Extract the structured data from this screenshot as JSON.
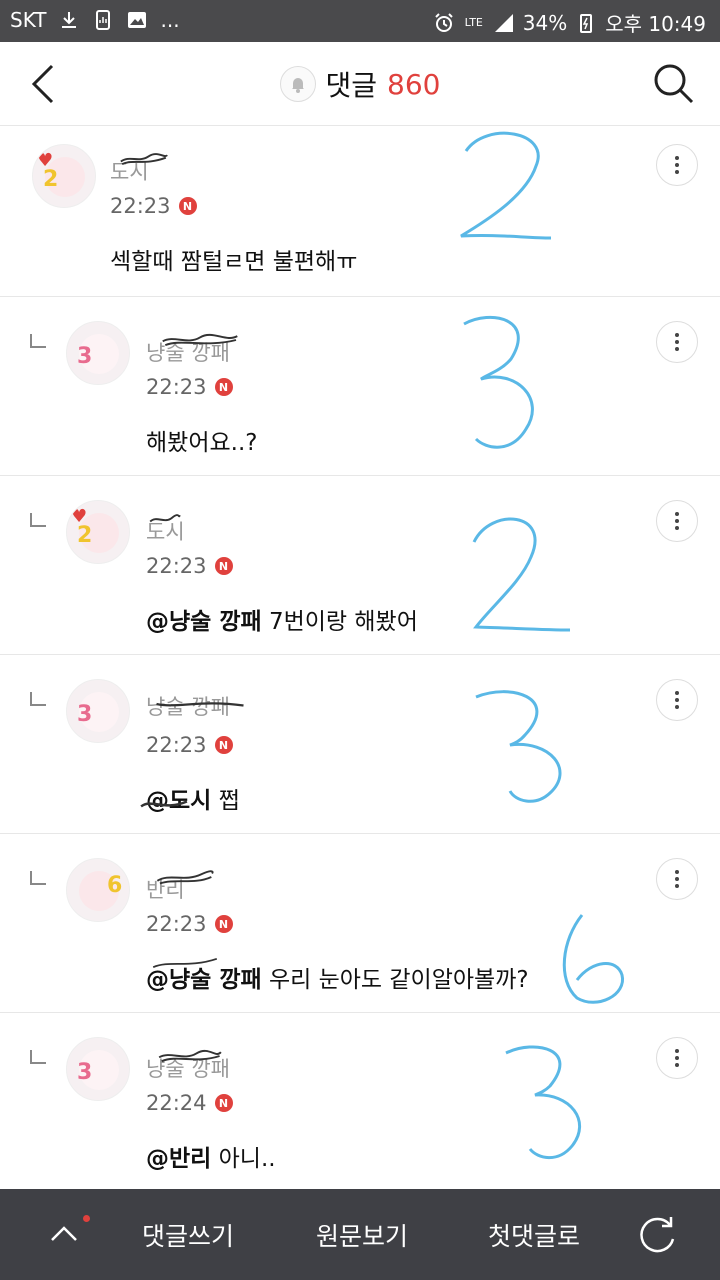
{
  "status_bar": {
    "carrier": "SKT",
    "dots": "...",
    "lte": "LTE",
    "battery": "34%",
    "time": "오후 10:49"
  },
  "header": {
    "title": "댓글",
    "count": "860"
  },
  "comments": [
    {
      "nickname": "도시",
      "time": "22:23",
      "badge": "N",
      "mention": "",
      "text": "섹할때 짬털ㄹ면 불편해ㅠ",
      "level": "2",
      "annotation": "2"
    },
    {
      "nickname": "냥술 깡패",
      "time": "22:23",
      "badge": "N",
      "mention": "",
      "text": "해봤어요..?",
      "level": "3",
      "annotation": "3"
    },
    {
      "nickname": "도시",
      "time": "22:23",
      "badge": "N",
      "mention": "@냥술 깡패",
      "text": " 7번이랑 해봤어",
      "level": "2",
      "annotation": "2"
    },
    {
      "nickname": "냥술 깡패",
      "time": "22:23",
      "badge": "N",
      "mention": "@도시",
      "text": " 쩝",
      "level": "3",
      "annotation": "3"
    },
    {
      "nickname": "반리",
      "time": "22:23",
      "badge": "N",
      "mention": "@냥술 깡패",
      "text": " 우리 눈아도 같이알아볼까?",
      "level": "6",
      "annotation": "6"
    },
    {
      "nickname": "냥술 깡패",
      "time": "22:24",
      "badge": "N",
      "mention": "@반리",
      "text": " 아니..",
      "level": "3",
      "annotation": "3"
    }
  ],
  "bottom_bar": {
    "write": "댓글쓰기",
    "original": "원문보기",
    "first": "첫댓글로"
  },
  "colors": {
    "accent": "#e0413d",
    "bottom_bg": "#3f4045",
    "status_bg": "#4a4a4c",
    "annotation_blue": "#5ab8e6"
  }
}
